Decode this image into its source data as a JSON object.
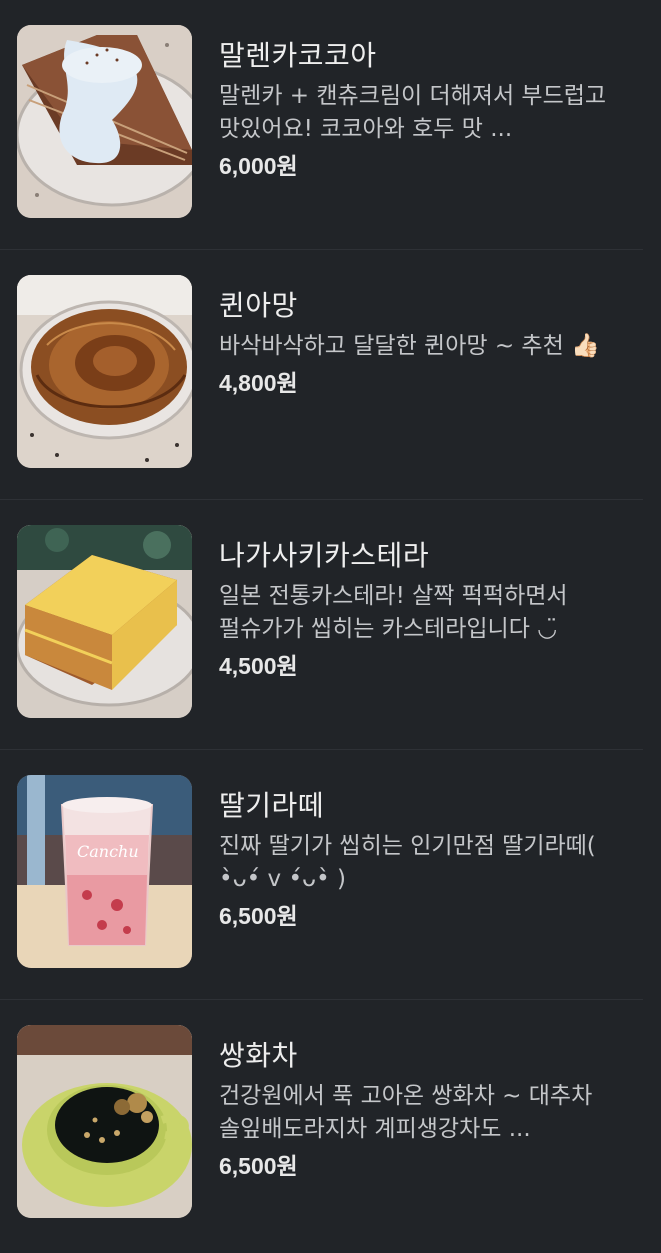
{
  "menu": {
    "items": [
      {
        "name": "말렌카코코아",
        "description": "말렌카 + 캔츄크림이 더해져서 부드럽고 맛있어요! 코코아와 호두 맛 ...",
        "price": "6,000원",
        "image": "chocolate-layer-cake-photo"
      },
      {
        "name": "퀸아망",
        "description": "바삭바삭하고 달달한 퀸아망 ~ 추천 👍🏻",
        "price": "4,800원",
        "image": "kouign-amann-pastry-photo"
      },
      {
        "name": "나가사키카스테라",
        "description": "일본 전통카스테라! 살짝 퍽퍽하면서 펄슈가가 씹히는 카스테라입니다 ◡̈",
        "price": "4,500원",
        "image": "castella-sponge-cake-photo"
      },
      {
        "name": "딸기라떼",
        "description": "진짜 딸기가 씹히는 인기만점 딸기라떼( •̀ᴗ•́ v •́ᴗ•̀ )",
        "price": "6,500원",
        "image": "strawberry-latte-photo",
        "cup_text": "Canchu"
      },
      {
        "name": "쌍화차",
        "description": "건강원에서 푹 고아온 쌍화차 ~ 대추차 솔잎배도라지차 계피생강차도 ...",
        "price": "6,500원",
        "image": "ssanghwa-tea-photo"
      }
    ]
  },
  "colors": {
    "background": "#212428",
    "divider": "#2e3136",
    "text_primary": "#eeeeee",
    "text_secondary": "#c4c6c9"
  }
}
